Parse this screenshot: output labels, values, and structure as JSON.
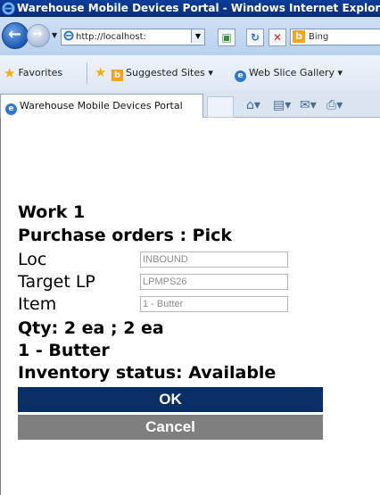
{
  "window": {
    "title": "Warehouse Mobile Devices Portal - Windows Internet Explorer"
  },
  "addressbar": {
    "url": "http://localhost:",
    "search_placeholder": "Bing"
  },
  "favorites_bar": {
    "favorites_label": "Favorites",
    "suggested_sites_label": "Suggested Sites ▾",
    "web_slice_gallery_label": "Web Slice Gallery ▾"
  },
  "tab": {
    "label": "Warehouse Mobile Devices Portal"
  },
  "page": {
    "work_title": "Work 1",
    "subtitle": "Purchase orders : Pick",
    "fields": [
      {
        "label": "Loc",
        "value": "INBOUND"
      },
      {
        "label": "Target LP",
        "value": "LPMPS26"
      },
      {
        "label": "Item",
        "value": "1 - Butter"
      }
    ],
    "qty_text": "Qty: 2 ea ; 2 ea",
    "item_text": "1 - Butter",
    "inventory_status": "Inventory status: Available",
    "ok_label": "OK",
    "cancel_label": "Cancel"
  },
  "colors": {
    "titlebar": "#0b3d98",
    "ok_button": "#0b2e66",
    "cancel_button": "#7f7f7f"
  }
}
